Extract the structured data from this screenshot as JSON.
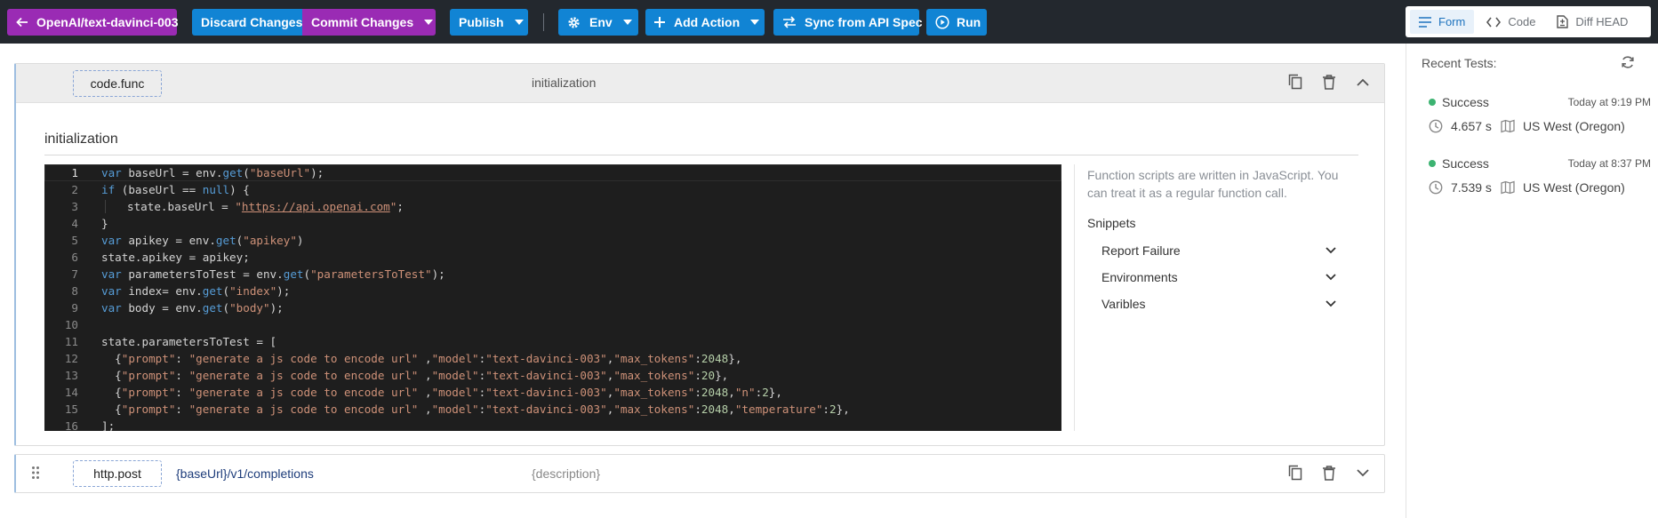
{
  "toolbar": {
    "back_label": "OpenAI/text-davinci-003",
    "discard_label": "Discard Changes",
    "commit_label": "Commit Changes",
    "publish_label": "Publish",
    "env_label": "Env",
    "add_action_label": "Add Action",
    "sync_label": "Sync from API Spec",
    "run_label": "Run",
    "view_tabs": [
      "Form",
      "Code",
      "Diff HEAD"
    ],
    "active_view": "Form"
  },
  "card1": {
    "type": "code.func",
    "header_title": "initialization",
    "section_title": "initialization"
  },
  "editor": {
    "line_numbers": [
      "1",
      "2",
      "3",
      "4",
      "5",
      "6",
      "7",
      "8",
      "9",
      "10",
      "11",
      "12",
      "13",
      "14",
      "15",
      "16"
    ]
  },
  "help_text": "Function scripts are written in JavaScript. You can treat it as a regular function call.",
  "snippets": {
    "title": "Snippets",
    "items": [
      "Report Failure",
      "Environments",
      "Varibles"
    ]
  },
  "card2": {
    "type": "http.post",
    "endpoint": "{baseUrl}/v1/completions",
    "description": "{description}"
  },
  "sidebar": {
    "title": "Recent Tests:",
    "tests": [
      {
        "status": "Success",
        "time": "Today at 9:19 PM",
        "duration": "4.657 s",
        "region": "US West (Oregon)"
      },
      {
        "status": "Success",
        "time": "Today at 8:37 PM",
        "duration": "7.539 s",
        "region": "US West (Oregon)"
      }
    ]
  },
  "colors": {
    "topbar": "#23282e",
    "purple": "#9a2bb4",
    "blue": "#1184d4",
    "success": "#3cb371"
  }
}
